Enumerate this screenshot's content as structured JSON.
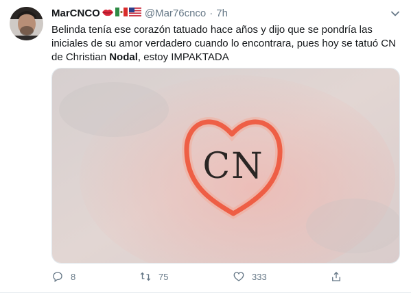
{
  "tweet": {
    "display_name": "MarCNCO",
    "handle": "@Mar76cnco",
    "separator": "·",
    "time": "7h",
    "text_parts": {
      "part1": "Belinda tenía ese corazón tatuado hace años y dijo que se pondría las iniciales de su amor verdadero cuando lo encontrara,  pues hoy se tatuó CN de Christian ",
      "bold": "Nodal",
      "part2": ",  estoy IMPAKTADA"
    },
    "media": {
      "tattoo_text": "CN"
    },
    "actions": {
      "replies": "8",
      "retweets": "75",
      "likes": "333"
    }
  },
  "icons": {
    "name_emojis": [
      "lips-icon",
      "mexico-flag-icon",
      "usa-flag-icon"
    ],
    "caret": "chevron-down-icon",
    "reply": "reply-icon",
    "retweet": "retweet-icon",
    "like": "heart-icon",
    "share": "share-icon"
  },
  "colors": {
    "text": "#14171a",
    "secondary": "#657786",
    "tattoo_outline": "#e8432a"
  }
}
